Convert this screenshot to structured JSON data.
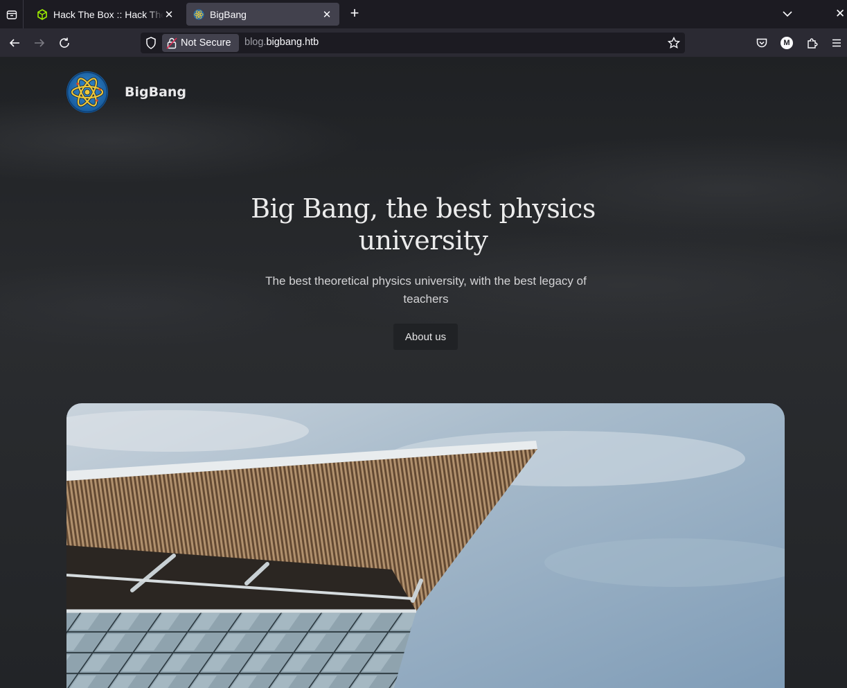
{
  "browser": {
    "tabs": [
      {
        "title": "Hack The Box :: Hack The Box",
        "active": false,
        "favicon": "cube-icon"
      },
      {
        "title": "BigBang",
        "active": true,
        "favicon": "atom-icon"
      }
    ],
    "security_label": "Not Secure",
    "url_subdomain": "blog.",
    "url_domain": "bigbang.htb",
    "profile_initial": "M"
  },
  "site": {
    "brand": "BigBang",
    "hero_title": "Big Bang, the best physics university",
    "hero_subtitle": "The best theoretical physics university, with the best legacy of teachers",
    "about_button": "About us"
  },
  "colors": {
    "page_bg": "#25272a",
    "chrome_bg": "#1c1b22",
    "toolbar_bg": "#2b2a33",
    "logo_ring": "#1d6fb0",
    "logo_atom": "#e7c43a"
  }
}
